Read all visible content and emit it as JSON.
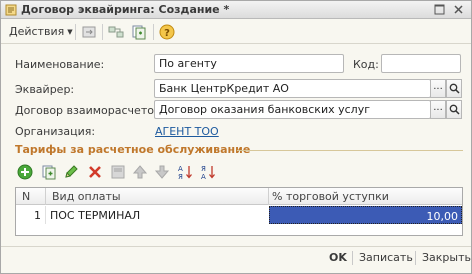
{
  "window": {
    "title": "Договор эквайринга: Создание *"
  },
  "toolbar": {
    "actions_label": "Действия",
    "help_glyph": "?"
  },
  "form": {
    "name_label": "Наименование:",
    "name_value": "По агенту",
    "code_label": "Код:",
    "code_value": "",
    "acquirer_label": "Эквайрер:",
    "acquirer_value": "Банк ЦентрКредит АО",
    "contract_label": "Договор взаиморасчетов:",
    "contract_value": "Договор оказания банковских услуг",
    "org_label": "Организация:",
    "org_value": "АГЕНТ ТОО",
    "select_glyph": "..."
  },
  "tariffs": {
    "section_title": "Тарифы за расчетное обслуживание",
    "columns": [
      "N",
      "Вид оплаты",
      "% торговой уступки"
    ],
    "rows": [
      {
        "n": "1",
        "payment_type": "ПОС ТЕРМИНАЛ",
        "discount": "10,00"
      }
    ]
  },
  "footer": {
    "ok_label": "OK",
    "save_label": "Записать",
    "close_label": "Закрыть"
  },
  "colors": {
    "accent_orange": "#c0782c",
    "link_blue": "#1d5a9e",
    "selection_blue": "#3c5bb5"
  }
}
